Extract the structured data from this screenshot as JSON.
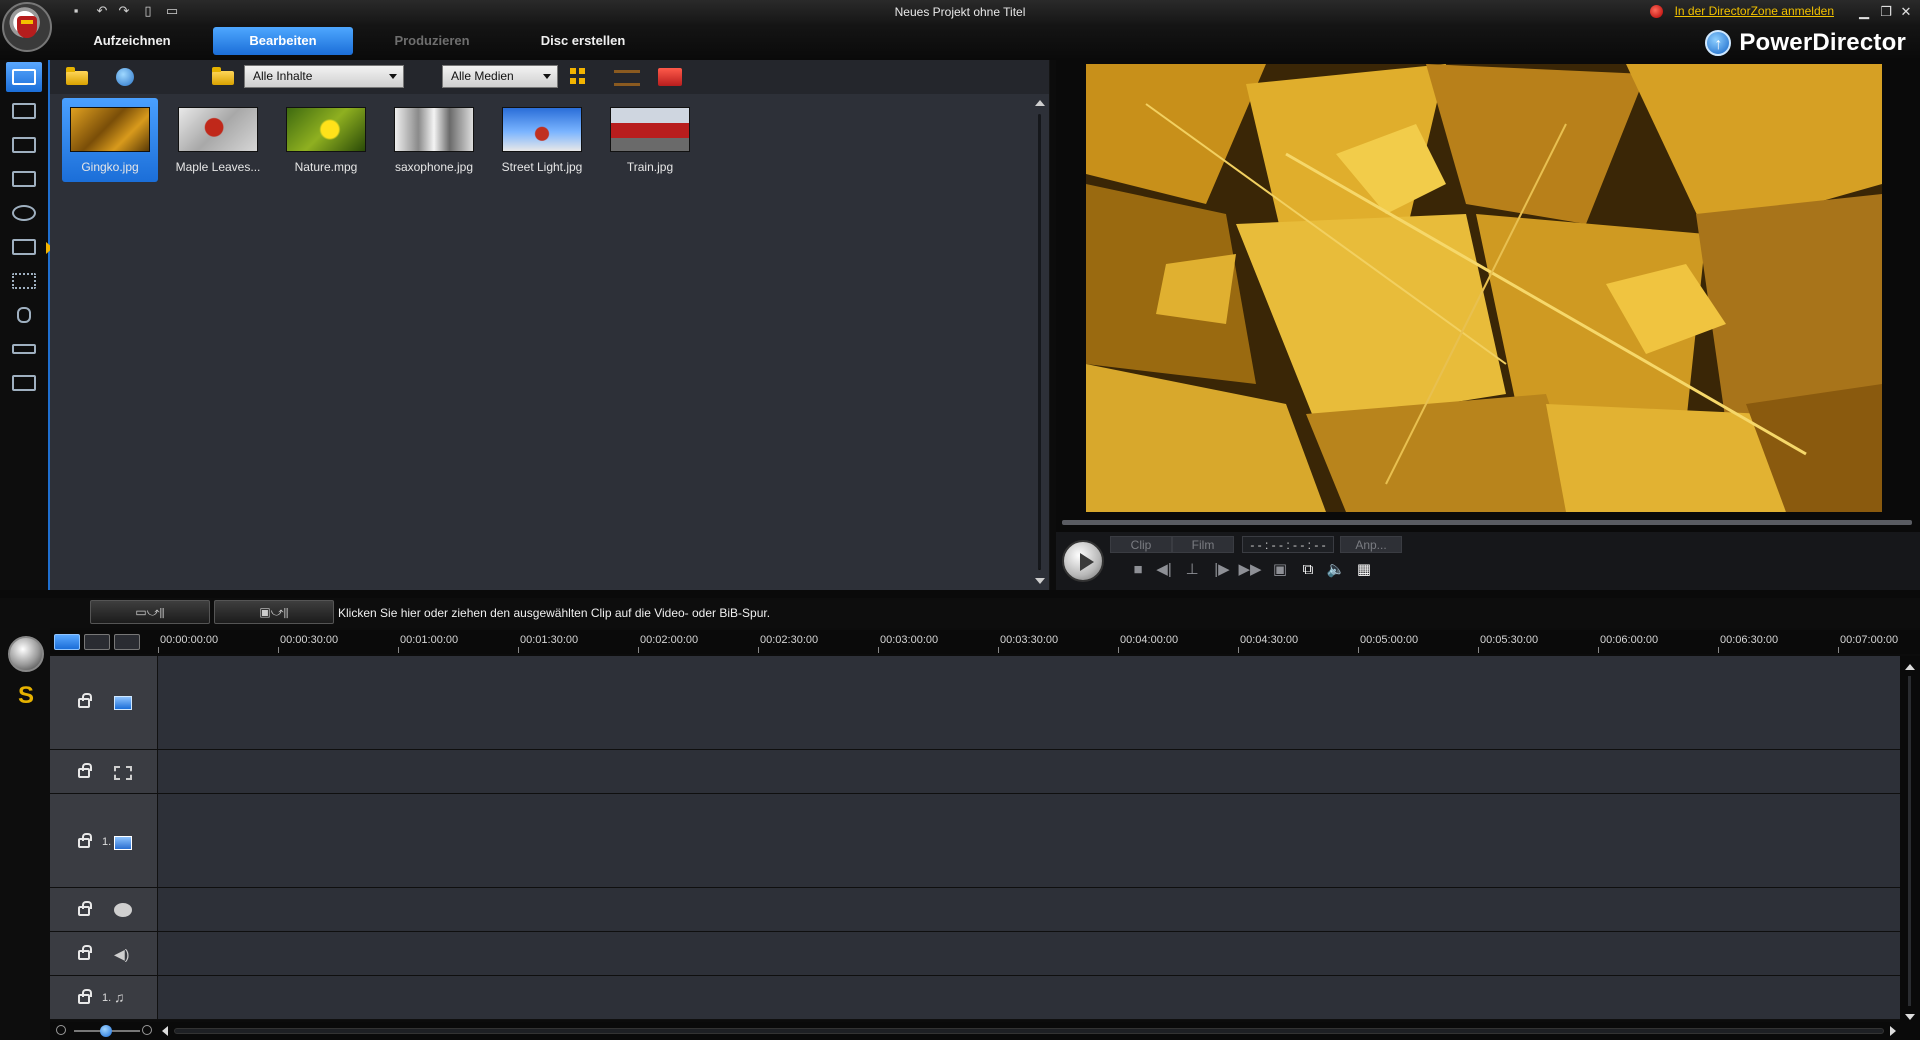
{
  "window": {
    "title": "Neues Projekt ohne Titel",
    "directorzone_link": "In der DirectorZone anmelden"
  },
  "nav": {
    "tabs": [
      {
        "label": "Aufzeichnen",
        "state": "normal"
      },
      {
        "label": "Bearbeiten",
        "state": "active"
      },
      {
        "label": "Produzieren",
        "state": "disabled"
      },
      {
        "label": "Disc erstellen",
        "state": "normal"
      }
    ],
    "brand": "PowerDirector"
  },
  "library": {
    "filter_content": "Alle Inhalte",
    "filter_media": "Alle Medien",
    "items": [
      {
        "label": "Gingko.jpg",
        "selected": true
      },
      {
        "label": "Maple Leaves...",
        "selected": false
      },
      {
        "label": "Nature.mpg",
        "selected": false
      },
      {
        "label": "saxophone.jpg",
        "selected": false
      },
      {
        "label": "Street Light.jpg",
        "selected": false
      },
      {
        "label": "Train.jpg",
        "selected": false
      }
    ]
  },
  "preview": {
    "mode_clip": "Clip",
    "mode_film": "Film",
    "timecode": "- - : - - : - - : - -",
    "fit": "Anp..."
  },
  "timeline": {
    "hint": "Klicken Sie hier oder ziehen den ausgewählten Clip auf die Video- oder BiB-Spur.",
    "ruler": [
      "00:00:00:00",
      "00:00:30:00",
      "00:01:00:00",
      "00:01:30:00",
      "00:02:00:00",
      "00:02:30:00",
      "00:03:00:00",
      "00:03:30:00",
      "00:04:00:00",
      "00:04:30:00",
      "00:05:00:00",
      "00:05:30:00",
      "00:06:00:00",
      "00:06:30:00",
      "00:07:00:00"
    ],
    "track_numbers": {
      "pip": "1.",
      "music": "1."
    }
  },
  "colors": {
    "accent": "#1b6ed8",
    "link": "#f2c200",
    "panel": "#2d3038"
  }
}
